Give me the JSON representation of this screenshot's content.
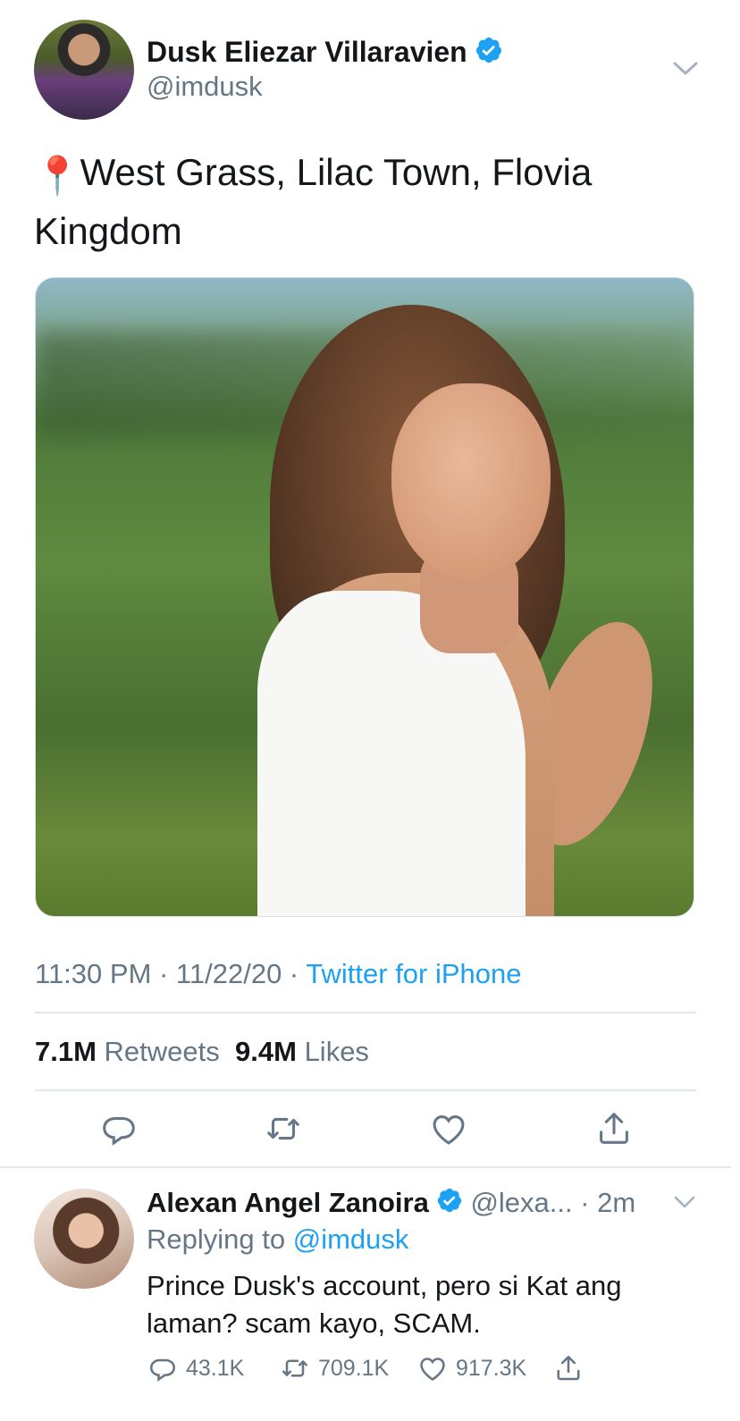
{
  "tweet": {
    "author_name": "Dusk Eliezar Villaravien",
    "author_handle": "@imdusk",
    "text": "West Grass, Lilac Town, Flovia Kingdom",
    "pin_emoji": "📍",
    "time": "11:30 PM · 11/22/20 · ",
    "source": "Twitter for iPhone",
    "retweets_count": "7.1M",
    "retweets_label": "Retweets",
    "likes_count": "9.4M",
    "likes_label": "Likes"
  },
  "reply": {
    "author_name": "Alexan Angel Zanoira",
    "author_handle": "@lexa...",
    "time": " · 2m",
    "replying_prefix": "Replying to ",
    "replying_to": "@imdusk",
    "text": "Prince Dusk's account, pero si Kat ang laman? scam kayo, SCAM.",
    "replies_count": "43.1K",
    "retweets_count": "709.1K",
    "likes_count": "917.3K"
  },
  "icons": {
    "verified": "verified-badge-icon",
    "chevron": "chevron-down-icon",
    "reply": "reply-icon",
    "retweet": "retweet-icon",
    "like": "heart-icon",
    "share": "share-icon"
  },
  "colors": {
    "accent": "#1da1f2",
    "secondary_text": "#657786",
    "primary_text": "#14171a",
    "divider": "#e1e8ed"
  }
}
